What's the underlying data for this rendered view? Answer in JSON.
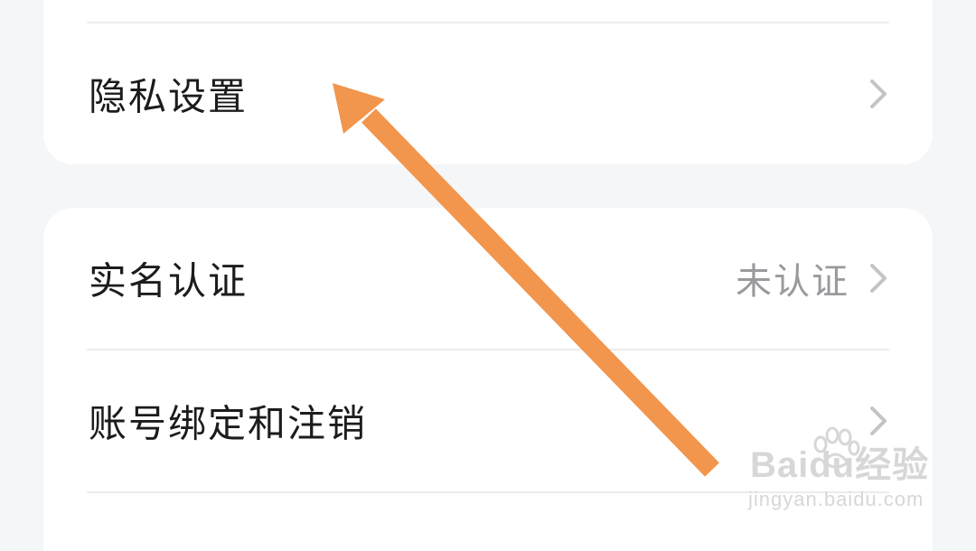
{
  "sections": [
    {
      "rows": [
        {
          "label": "隐私设置",
          "value": "",
          "icon": "chevron-right-icon"
        }
      ]
    },
    {
      "rows": [
        {
          "label": "实名认证",
          "value": "未认证",
          "icon": "chevron-right-icon"
        },
        {
          "label": "账号绑定和注销",
          "value": "",
          "icon": "chevron-right-icon"
        }
      ]
    }
  ],
  "annotation": {
    "icon": "pointer-arrow-icon",
    "color": "#f2954d"
  },
  "watermark": {
    "logo": "Baidu经验",
    "site": "jingyan.baidu.com"
  },
  "colors": {
    "background": "#f5f6f8",
    "card": "#ffffff",
    "label_text": "#1c1c1e",
    "value_text": "#9a9a9e",
    "chevron": "#c4c4c8",
    "divider": "#ececee"
  }
}
